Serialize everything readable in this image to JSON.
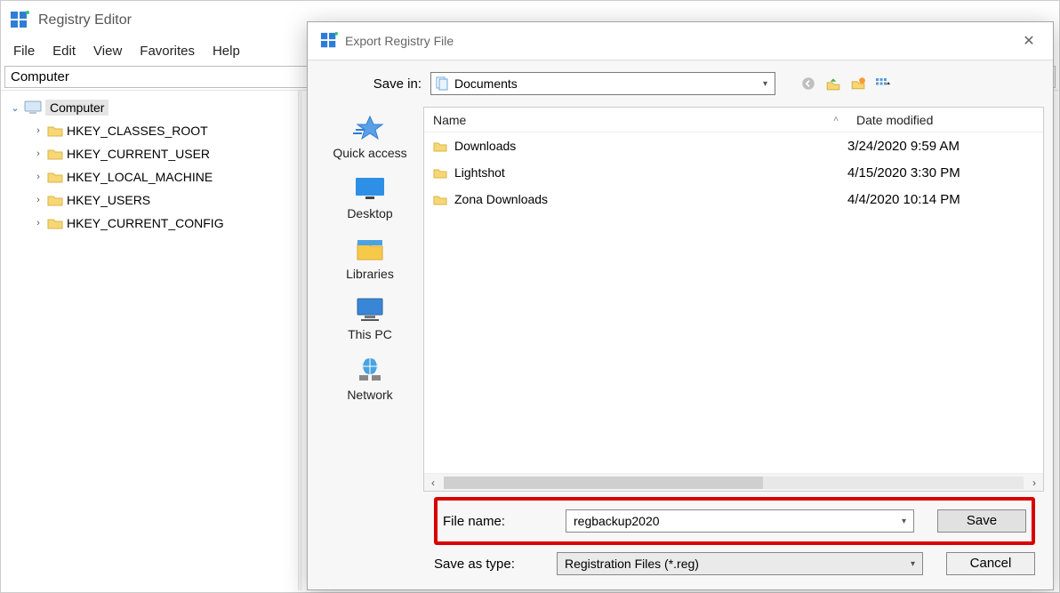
{
  "app": {
    "title": "Registry Editor"
  },
  "menu": {
    "file": "File",
    "edit": "Edit",
    "view": "View",
    "favorites": "Favorites",
    "help": "Help"
  },
  "addressBar": "Computer",
  "tree": {
    "root": "Computer",
    "keys": [
      "HKEY_CLASSES_ROOT",
      "HKEY_CURRENT_USER",
      "HKEY_LOCAL_MACHINE",
      "HKEY_USERS",
      "HKEY_CURRENT_CONFIG"
    ]
  },
  "dialog": {
    "title": "Export Registry File",
    "saveInLabel": "Save in:",
    "saveInValue": "Documents",
    "toolbarIcons": [
      "back-icon",
      "up-icon",
      "new-folder-icon",
      "views-icon"
    ],
    "places": {
      "quickAccess": "Quick access",
      "desktop": "Desktop",
      "libraries": "Libraries",
      "thisPC": "This PC",
      "network": "Network"
    },
    "columns": {
      "name": "Name",
      "dateModified": "Date modified"
    },
    "files": [
      {
        "name": "Downloads",
        "date": "3/24/2020 9:59 AM"
      },
      {
        "name": "Lightshot",
        "date": "4/15/2020 3:30 PM"
      },
      {
        "name": "Zona Downloads",
        "date": "4/4/2020 10:14 PM"
      }
    ],
    "fileNameLabel": "File name:",
    "fileNameValue": "regbackup2020",
    "saveAsTypeLabel": "Save as type:",
    "saveAsTypeValue": "Registration Files (*.reg)",
    "saveButton": "Save",
    "cancelButton": "Cancel"
  }
}
